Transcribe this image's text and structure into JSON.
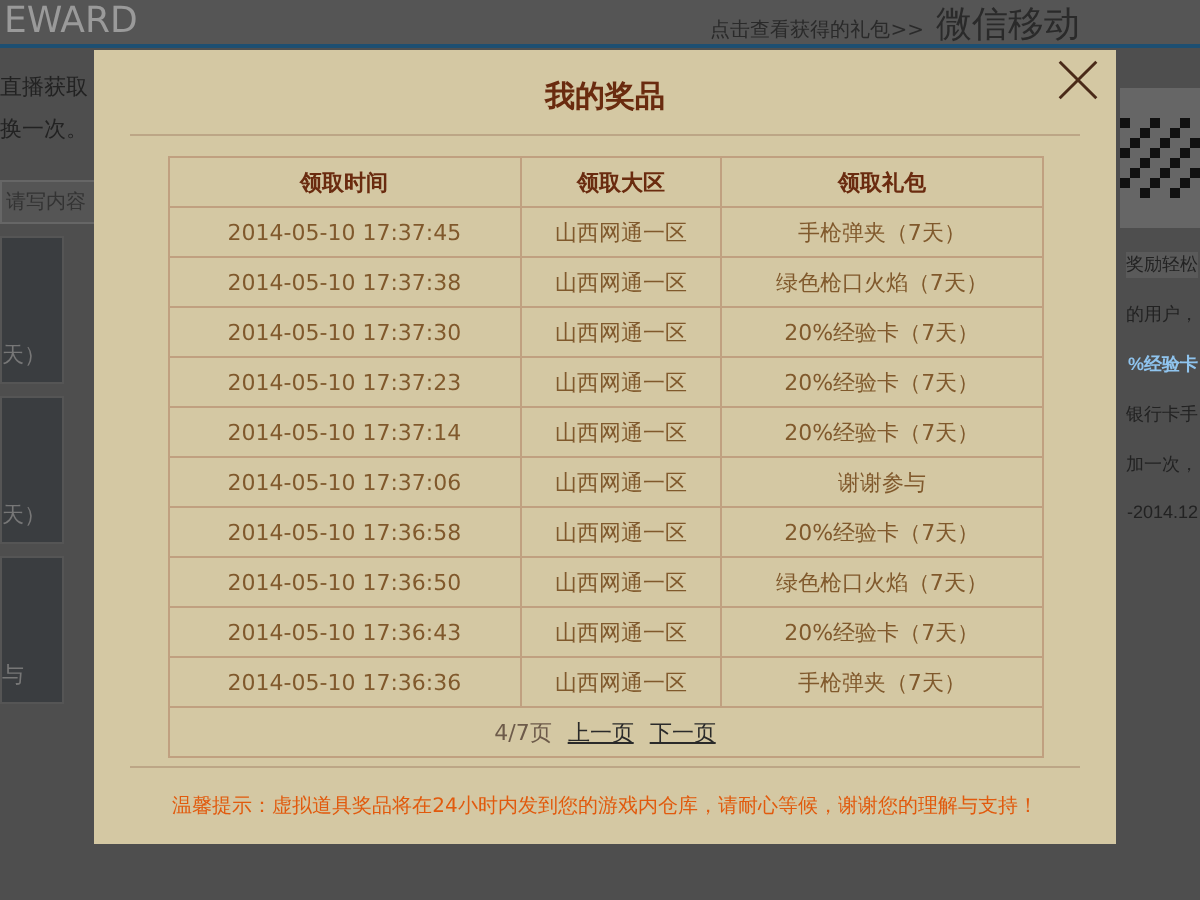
{
  "page": {
    "logo_text": "EWARD",
    "header_link": "点击查看获得的礼包>>",
    "header_title": "微信移动",
    "left_texts": [
      "直播获取",
      "换一次。"
    ],
    "search": {
      "placeholder": "请写内容"
    },
    "left_tiles": [
      {
        "caption": "天）"
      },
      {
        "caption": "天）"
      },
      {
        "caption": "与"
      }
    ],
    "right_texts": [
      {
        "text": "奖励轻松",
        "kind": "heading"
      },
      {
        "text": "的用户，",
        "kind": "plain"
      },
      {
        "text": "%经验卡",
        "kind": "link"
      },
      {
        "text": "银行卡手",
        "kind": "plain"
      },
      {
        "text": "加一次，",
        "kind": "plain"
      },
      {
        "text": "-2014.12",
        "kind": "plain"
      }
    ]
  },
  "dialog": {
    "title": "我的奖品",
    "table": {
      "columns": [
        "领取时间",
        "领取大区",
        "领取礼包"
      ],
      "rows": [
        [
          "2014-05-10 17:37:45",
          "山西网通一区",
          "手枪弹夹（7天）"
        ],
        [
          "2014-05-10 17:37:38",
          "山西网通一区",
          "绿色枪口火焰（7天）"
        ],
        [
          "2014-05-10 17:37:30",
          "山西网通一区",
          "20%经验卡（7天）"
        ],
        [
          "2014-05-10 17:37:23",
          "山西网通一区",
          "20%经验卡（7天）"
        ],
        [
          "2014-05-10 17:37:14",
          "山西网通一区",
          "20%经验卡（7天）"
        ],
        [
          "2014-05-10 17:37:06",
          "山西网通一区",
          "谢谢参与"
        ],
        [
          "2014-05-10 17:36:58",
          "山西网通一区",
          "20%经验卡（7天）"
        ],
        [
          "2014-05-10 17:36:50",
          "山西网通一区",
          "绿色枪口火焰（7天）"
        ],
        [
          "2014-05-10 17:36:43",
          "山西网通一区",
          "20%经验卡（7天）"
        ],
        [
          "2014-05-10 17:36:36",
          "山西网通一区",
          "手枪弹夹（7天）"
        ]
      ]
    },
    "pagination": {
      "page": "4/7页",
      "prev": "上一页",
      "next": "下一页"
    },
    "notice": "温馨提示：虚拟道具奖品将在24小时内发到您的游戏内仓库，请耐心等候，谢谢您的理解与支持！"
  }
}
